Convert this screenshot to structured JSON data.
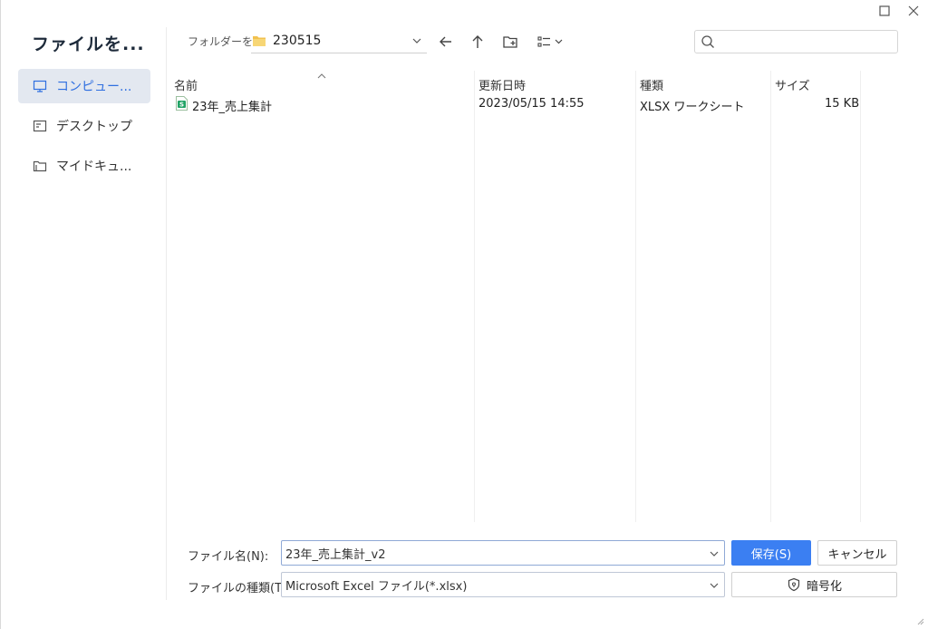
{
  "window": {
    "maximize_icon": "maximize-icon",
    "close_icon": "close-icon"
  },
  "sidebar": {
    "title": "ファイルを...",
    "items": [
      {
        "label": "コンピュー...",
        "icon": "computer-icon",
        "active": true
      },
      {
        "label": "デスクトップ",
        "icon": "desktop-icon",
        "active": false
      },
      {
        "label": "マイドキュ...",
        "icon": "documents-icon",
        "active": false
      }
    ]
  },
  "toolbar": {
    "path_label": "フォルダーを:",
    "path_value": "230515",
    "back_icon": "back-arrow-icon",
    "up_icon": "up-arrow-icon",
    "new_folder_icon": "new-folder-icon",
    "view_icon": "view-options-icon",
    "search_placeholder": ""
  },
  "list": {
    "columns": [
      "名前",
      "更新日時",
      "種類",
      "サイズ"
    ],
    "rows": [
      {
        "name": "23年_売上集計",
        "modified": "2023/05/15 14:55",
        "type": "XLSX ワークシート",
        "size": "15 KB"
      }
    ]
  },
  "form": {
    "filename_label": "ファイル名(N):",
    "filename_value": "23年_売上集計_v2",
    "filetype_label": "ファイルの種類(T):",
    "filetype_value": "Microsoft Excel ファイル(*.xlsx)",
    "save_label": "保存(S)",
    "cancel_label": "キャンセル",
    "encrypt_label": "暗号化"
  },
  "colors": {
    "accent": "#3b7ff2",
    "active_bg": "#e3e8f0",
    "excel_green": "#21a366"
  }
}
